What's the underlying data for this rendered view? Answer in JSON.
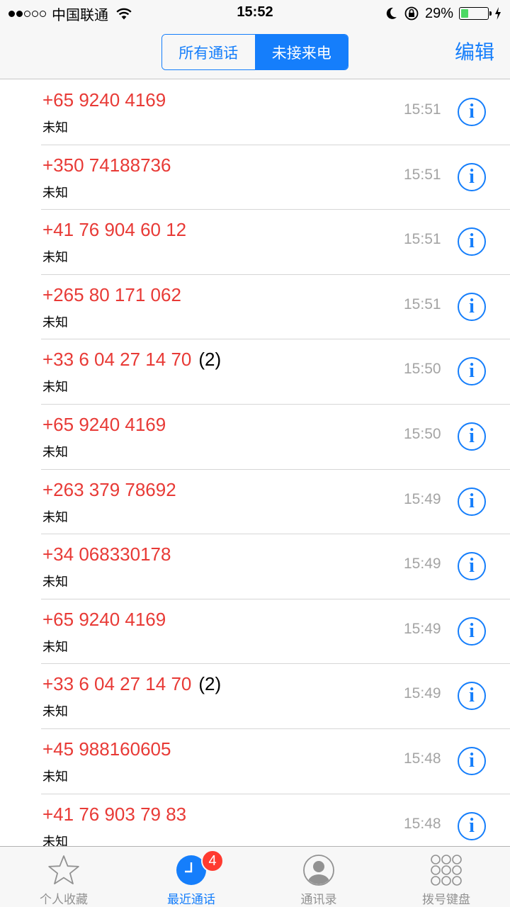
{
  "status_bar": {
    "signal_full": 2,
    "signal_empty": 3,
    "carrier": "中国联通",
    "time": "15:52",
    "battery_percent": "29%",
    "battery_level": 0.29,
    "icons": [
      "wifi-icon",
      "moon-icon",
      "orientation-lock-icon",
      "battery-icon",
      "charging-icon"
    ]
  },
  "nav": {
    "segments": [
      "所有通话",
      "未接来电"
    ],
    "selected_segment": "未接来电",
    "edit_label": "编辑"
  },
  "calls": [
    {
      "number": "+65 9240 4169",
      "count": "",
      "label": "未知",
      "time": "15:51"
    },
    {
      "number": "+350 74188736",
      "count": "",
      "label": "未知",
      "time": "15:51"
    },
    {
      "number": "+41 76 904 60 12",
      "count": "",
      "label": "未知",
      "time": "15:51"
    },
    {
      "number": "+265 80 171 062",
      "count": "",
      "label": "未知",
      "time": "15:51"
    },
    {
      "number": "+33 6 04 27 14 70",
      "count": "(2)",
      "label": "未知",
      "time": "15:50"
    },
    {
      "number": "+65 9240 4169",
      "count": "",
      "label": "未知",
      "time": "15:50"
    },
    {
      "number": "+263 379 78692",
      "count": "",
      "label": "未知",
      "time": "15:49"
    },
    {
      "number": "+34 068330178",
      "count": "",
      "label": "未知",
      "time": "15:49"
    },
    {
      "number": "+65 9240 4169",
      "count": "",
      "label": "未知",
      "time": "15:49"
    },
    {
      "number": "+33 6 04 27 14 70",
      "count": "(2)",
      "label": "未知",
      "time": "15:49"
    },
    {
      "number": "+45 988160605",
      "count": "",
      "label": "未知",
      "time": "15:48"
    },
    {
      "number": "+41 76 903 79 83",
      "count": "",
      "label": "未知",
      "time": "15:48"
    }
  ],
  "info_glyph": "i",
  "tabs": [
    {
      "label": "个人收藏",
      "icon": "star-icon",
      "active": false
    },
    {
      "label": "最近通话",
      "icon": "clock-icon",
      "active": true,
      "badge": "4"
    },
    {
      "label": "通讯录",
      "icon": "contacts-icon",
      "active": false
    },
    {
      "label": "拨号键盘",
      "icon": "keypad-icon",
      "active": false
    }
  ],
  "colors": {
    "accent": "#157efb",
    "missed": "#e83a36",
    "time": "#a4a4a4",
    "badge": "#ff3b30",
    "battery": "#4cd964"
  }
}
